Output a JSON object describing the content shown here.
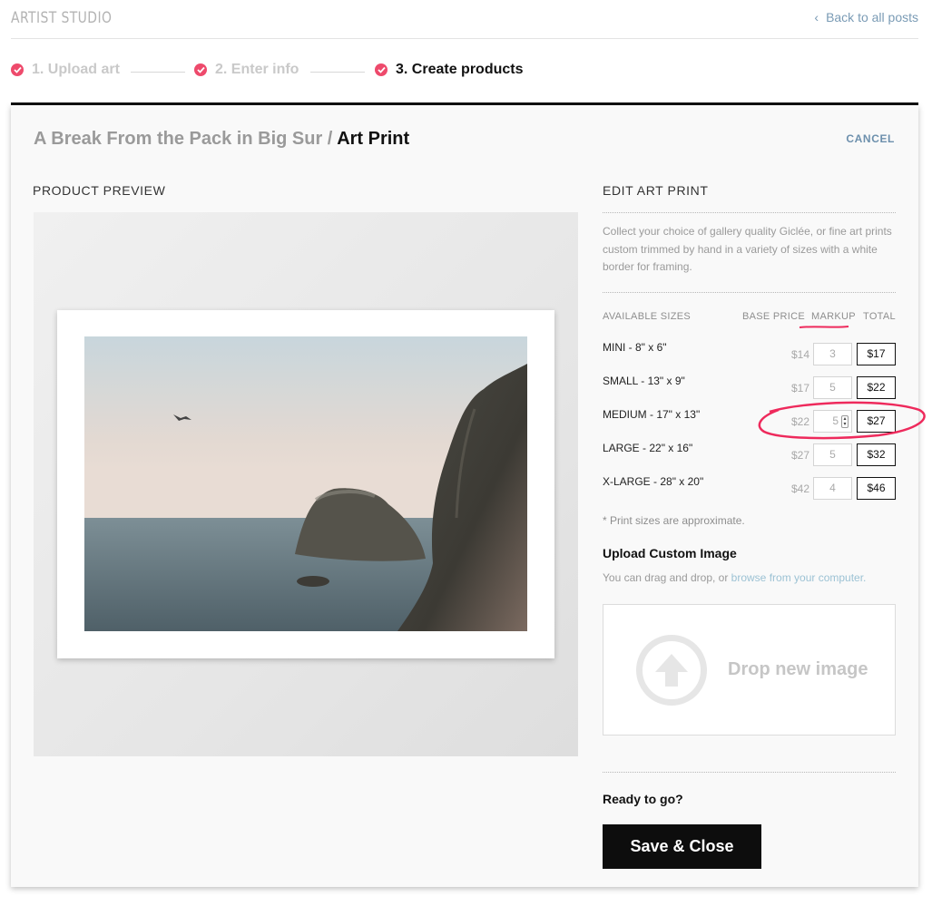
{
  "header": {
    "brand": "ARTIST STUDIO",
    "back_link": "Back to all posts"
  },
  "steps": [
    {
      "label": "1. Upload art",
      "state": "done"
    },
    {
      "label": "2. Enter info",
      "state": "done"
    },
    {
      "label": "3. Create products",
      "state": "active"
    }
  ],
  "card": {
    "title_prefix": "A Break From the Pack in Big Sur /",
    "title_product": "Art Print",
    "cancel_label": "CANCEL"
  },
  "preview": {
    "label": "PRODUCT PREVIEW"
  },
  "editor": {
    "label": "EDIT ART PRINT",
    "description": "Collect your choice of gallery quality Giclée, or fine art prints custom trimmed by hand in a variety of sizes with a white border for framing.",
    "columns": {
      "sizes": "AVAILABLE SIZES",
      "base_price": "BASE PRICE",
      "markup": "MARKUP",
      "total": "TOTAL"
    },
    "sizes": [
      {
        "name": "MINI - 8\" x 6\"",
        "base": "$14",
        "markup": "3",
        "total": "$17"
      },
      {
        "name": "SMALL - 13\" x 9\"",
        "base": "$17",
        "markup": "5",
        "total": "$22"
      },
      {
        "name": "MEDIUM - 17\" x 13\"",
        "base": "$22",
        "markup": "5",
        "total": "$27"
      },
      {
        "name": "LARGE - 22\" x 16\"",
        "base": "$27",
        "markup": "5",
        "total": "$32"
      },
      {
        "name": "X-LARGE - 28\" x 20\"",
        "base": "$42",
        "markup": "4",
        "total": "$46"
      }
    ],
    "note": "* Print sizes are approximate.",
    "upload": {
      "title": "Upload Custom Image",
      "hint_prefix": "You can drag and drop, or",
      "hint_link": "browse from your computer.",
      "drop_text": "Drop new image"
    },
    "ready": "Ready to go?",
    "save_label": "Save & Close"
  },
  "colors": {
    "accent_pink": "#ee4a6c",
    "link_blue": "#7a9bb5",
    "button_black": "#0d0d0d"
  }
}
